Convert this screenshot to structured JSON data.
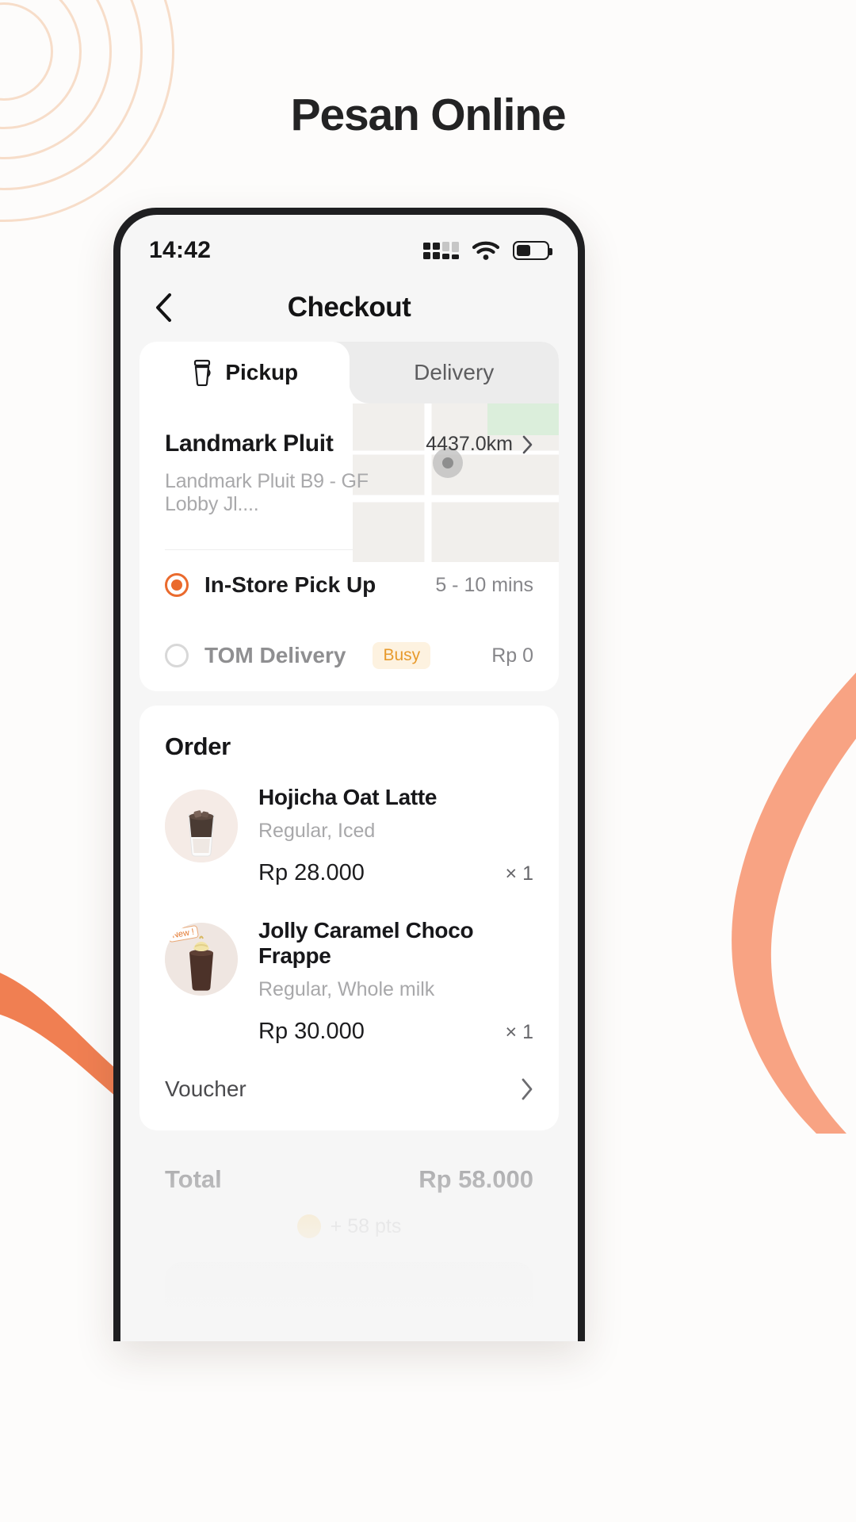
{
  "page": {
    "headline": "Pesan Online",
    "accent_color": "#ea6a2d",
    "background_color": "#fdfcfb"
  },
  "phone": {
    "status_bar": {
      "time": "14:42",
      "signal_icon": "signal-bars-icon",
      "wifi_icon": "wifi-icon",
      "battery_icon": "battery-icon",
      "battery_level_pct": 48
    },
    "nav": {
      "back_icon": "chevron-left-icon",
      "title": "Checkout"
    },
    "tabs": [
      {
        "label": "Pickup",
        "icon": "coffee-cup-icon",
        "active": true
      },
      {
        "label": "Delivery",
        "icon": "",
        "active": false
      }
    ],
    "store": {
      "name": "Landmark Pluit",
      "address": "Landmark Pluit B9 - GF Lobby Jl....",
      "distance": "4437.0km",
      "distance_chevron": "chevron-right-icon"
    },
    "pickup_options": [
      {
        "label": "In-Store Pick Up",
        "selected": true,
        "badge": "",
        "right": "5 - 10 mins"
      },
      {
        "label": "TOM Delivery",
        "selected": false,
        "badge": "Busy",
        "right": "Rp 0"
      }
    ],
    "order": {
      "title": "Order",
      "items": [
        {
          "name": "Hojicha Oat Latte",
          "options": "Regular, Iced",
          "price": "Rp 28.000",
          "qty": "× 1",
          "tag": ""
        },
        {
          "name": "Jolly Caramel Choco Frappe",
          "options": "Regular, Whole milk",
          "price": "Rp 30.000",
          "qty": "× 1",
          "tag": "New !"
        }
      ],
      "voucher_label": "Voucher",
      "voucher_chevron": "chevron-right-icon"
    },
    "summary": {
      "total_label": "Total",
      "total_value": "Rp 58.000",
      "points_text": "+ 58 pts"
    }
  }
}
